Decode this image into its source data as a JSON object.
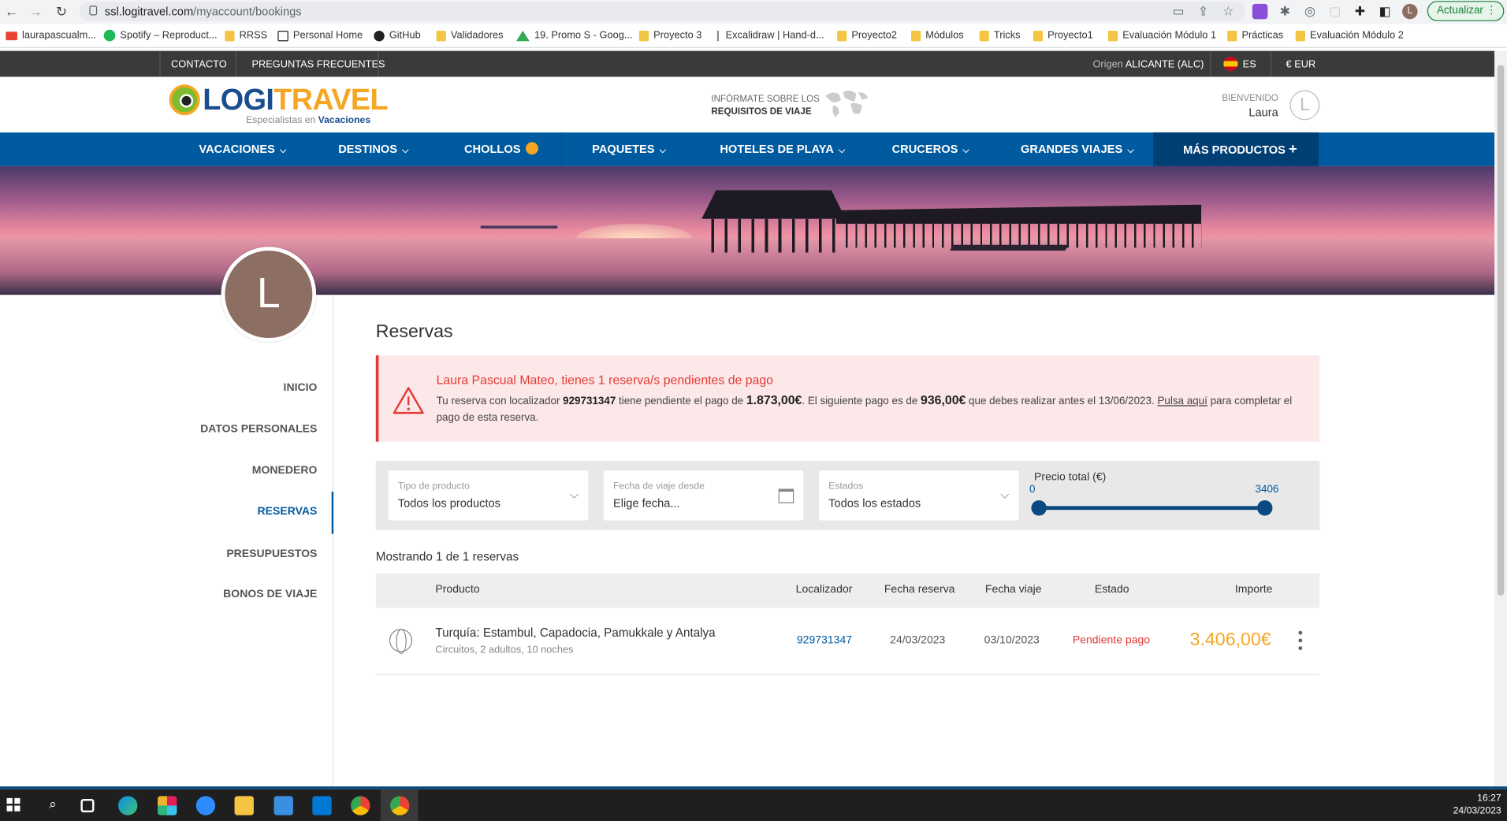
{
  "browser": {
    "url_host": "ssl.logitravel.com",
    "url_path": "/myaccount/bookings",
    "update_label": "Actualizar",
    "bookmarks": [
      "laurapascualm...",
      "Spotify – Reproduct...",
      "RRSS",
      "Personal Home",
      "GitHub",
      "Validadores",
      "19. Promo S - Goog...",
      "Proyecto 3",
      "Excalidraw | Hand-d...",
      "Proyecto2",
      "Módulos",
      "Tricks",
      "Proyecto1",
      "Evaluación Módulo 1",
      "Prácticas",
      "Evaluación Módulo 2"
    ]
  },
  "topbar": {
    "contact": "CONTACTO",
    "faq": "PREGUNTAS FRECUENTES",
    "origin_label": "Origen",
    "origin_value": "ALICANTE (ALC)",
    "lang": "ES",
    "currency": "€  EUR"
  },
  "header": {
    "logo_a": "LOGI",
    "logo_b": "TRAVEL",
    "logo_sub_a": "Especialistas en",
    "logo_sub_b": "Vacaciones",
    "req_line1": "INFÓRMATE SOBRE LOS",
    "req_line2": "REQUISITOS DE VIAJE",
    "welcome_label": "BIENVENIDO",
    "welcome_name": "Laura",
    "avatar_letter": "L"
  },
  "nav": {
    "items": [
      "VACACIONES",
      "DESTINOS",
      "CHOLLOS",
      "PAQUETES",
      "HOTELES DE PLAYA",
      "CRUCEROS",
      "GRANDES VIAJES",
      "MÁS PRODUCTOS"
    ],
    "more_symbol": "+"
  },
  "sidebar": {
    "avatar_letter": "L",
    "items": [
      "INICIO",
      "DATOS PERSONALES",
      "MONEDERO",
      "RESERVAS",
      "PRESUPUESTOS",
      "BONOS DE VIAJE"
    ],
    "active": "RESERVAS"
  },
  "main": {
    "title": "Reservas",
    "alert": {
      "title": "Laura Pascual Mateo, tienes 1 reserva/s pendientes de pago",
      "t1": "Tu reserva con localizador ",
      "locator": "929731347",
      "t2": " tiene pendiente el pago de ",
      "pending": "1.873,00€",
      "t3": ". El siguiente pago es de ",
      "next": "936,00€",
      "t4": " que debes realizar antes el 13/06/2023. ",
      "link": "Pulsa aquí",
      "t5": " para completar el pago de esta reserva."
    },
    "filters": {
      "product_label": "Tipo de producto",
      "product_value": "Todos los productos",
      "date_label": "Fecha de viaje desde",
      "date_placeholder": "Elige fecha...",
      "status_label": "Estados",
      "status_value": "Todos los estados",
      "price_label": "Precio total (€)",
      "price_min": "0",
      "price_max": "3406"
    },
    "showing": "Mostrando 1 de 1 reservas",
    "columns": [
      "Producto",
      "Localizador",
      "Fecha reserva",
      "Fecha viaje",
      "Estado",
      "Importe"
    ],
    "rows": [
      {
        "product": "Turquía: Estambul, Capadocia, Pamukkale y Antalya",
        "detail": "Circuitos, 2 adultos, 10 noches",
        "locator": "929731347",
        "booking_date": "24/03/2023",
        "travel_date": "03/10/2023",
        "status": "Pendiente pago",
        "amount": "3.406,00€"
      }
    ]
  },
  "taskbar": {
    "time": "16:27",
    "date": "24/03/2023"
  },
  "colors": {
    "brand_blue": "#005aa0",
    "accent_orange": "#f5a623",
    "alert_red": "#e53935"
  }
}
